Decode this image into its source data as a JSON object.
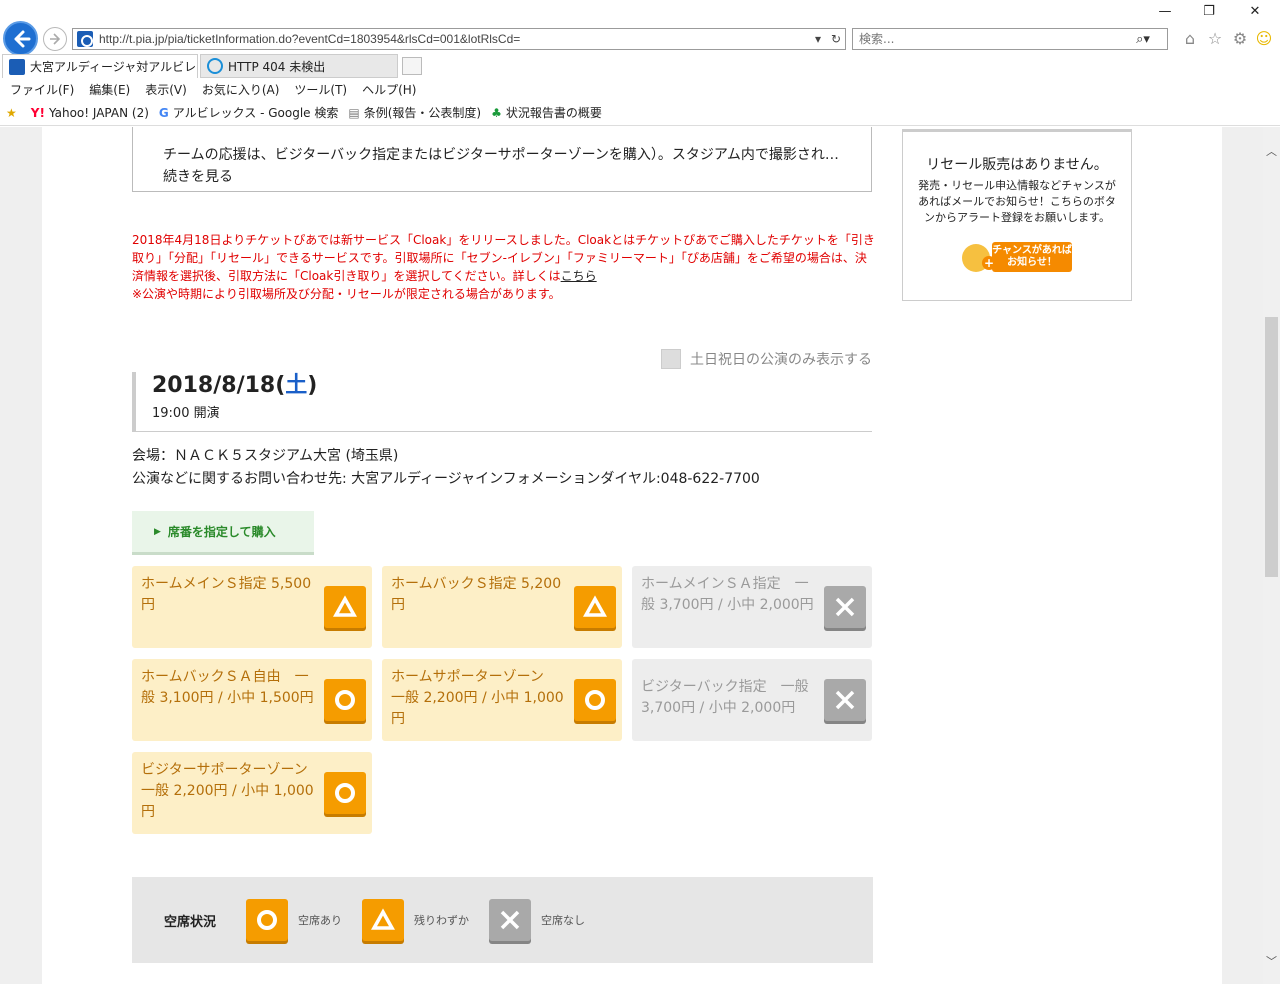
{
  "browser": {
    "url": "http://t.pia.jp/pia/ticketInformation.do?eventCd=1803954&rlsCd=001&lotRlsCd=",
    "search_placeholder": "検索...",
    "tabs": [
      {
        "label": "大宮アルディージャ対アルビレッ..."
      },
      {
        "label": "HTTP 404 未検出"
      }
    ],
    "menu": [
      "ファイル(F)",
      "編集(E)",
      "表示(V)",
      "お気に入り(A)",
      "ツール(T)",
      "ヘルプ(H)"
    ],
    "favorites": [
      {
        "label": "Yahoo! JAPAN (2)",
        "icon": "yahoo-icon"
      },
      {
        "label": "アルビレックス - Google 検索",
        "icon": "google-icon"
      },
      {
        "label": "条例(報告・公表制度)",
        "icon": "page-icon"
      },
      {
        "label": "状況報告書の概要",
        "icon": "tree-icon"
      }
    ]
  },
  "page": {
    "description_text": "チームの応援は、ビジターバック指定またはビジターサポーターゾーンを購入）。スタジアム内で撮影され…続きを見る",
    "notice": {
      "main": "2018年4月18日よりチケットぴあでは新サービス「Cloak」をリリースしました。Cloakとはチケットぴあでご購入したチケットを「引き取り」「分配」「リセール」できるサービスです。引取場所に「セブン-イレブン」「ファミリーマート」「ぴあ店舗」をご希望の場合は、決済情報を選択後、引取方法に「Cloak引き取り」を選択してください。詳しくは",
      "link": "こちら",
      "note": "※公演や時期により引取場所及び分配・リセールが限定される場合があります。"
    },
    "weekend_filter_label": "土日祝日の公演のみ表示する",
    "event": {
      "date": "2018/8/18(",
      "day_of_week": "土",
      "date_close": ")",
      "time": "19:00 開演",
      "venue": "会場：ＮＡＣＫ５スタジアム大宮 (埼玉県)",
      "contact": "公演などに関するお問い合わせ先: 大宮アルディージャインフォメーションダイヤル:048-622-7700"
    },
    "seat_select_button": "席番を指定して購入",
    "tickets": [
      {
        "label": "ホームメインＳ指定 5,500円",
        "status": "few"
      },
      {
        "label": "ホームバックＳ指定 5,200円",
        "status": "few"
      },
      {
        "label": "ホームメインＳＡ指定　一般 3,700円 / 小中 2,000円",
        "status": "none"
      },
      {
        "label": "ホームバックＳＡ自由　一般 3,100円 / 小中 1,500円",
        "status": "available"
      },
      {
        "label": "ホームサポーターゾーン　一般 2,200円 / 小中 1,000円",
        "status": "available"
      },
      {
        "label": "ビジターバック指定　一般 3,700円 / 小中 2,000円",
        "status": "none"
      },
      {
        "label": "ビジターサポーターゾーン　一般 2,200円 / 小中 1,000円",
        "status": "available"
      }
    ],
    "legend": {
      "title": "空席状況",
      "available": "空席あり",
      "few": "残りわずか",
      "none": "空席なし"
    },
    "resale": {
      "title": "リセール販売はありません。",
      "text": "発売・リセール申込情報などチャンスがあればメールでお知らせ！こちらのボタンからアラート登録をお願いします。",
      "button": "チャンスがあればお知らせ！"
    }
  },
  "colors": {
    "ticket_available_bg": "#fdefc7",
    "ticket_available_text": "#b46f0a",
    "ticket_soldout_bg": "#ededed",
    "mark_orange": "#f59c00",
    "mark_gray": "#a9a9a9",
    "notice_red": "#e00000",
    "date_blue": "#1a5fc8"
  }
}
